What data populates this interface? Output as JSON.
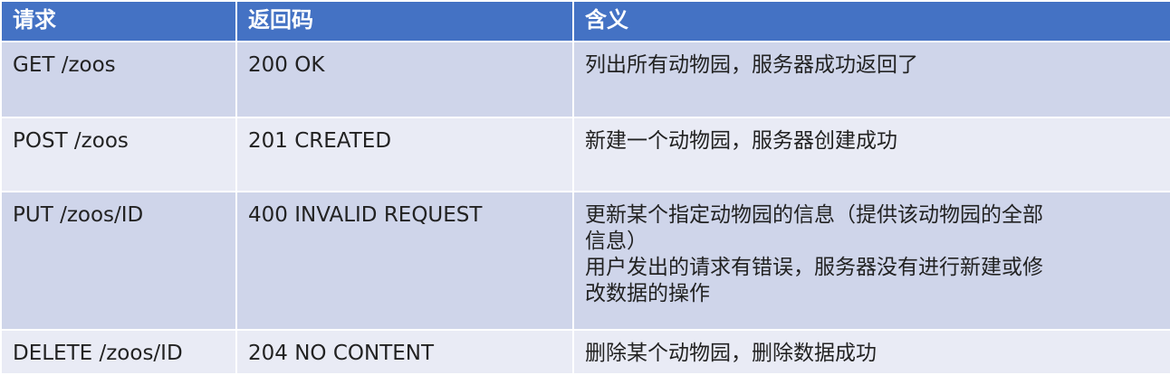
{
  "table": {
    "headers": [
      "请求",
      "返回码",
      "含义"
    ],
    "rows": [
      {
        "request": "GET /zoos",
        "code": "200 OK",
        "meaning": [
          "列出所有动物园，服务器成功返回了"
        ]
      },
      {
        "request": "POST /zoos",
        "code": "201 CREATED",
        "meaning": [
          "新建一个动物园，服务器创建成功"
        ]
      },
      {
        "request": "PUT /zoos/ID",
        "code": "400 INVALID REQUEST",
        "meaning": [
          "更新某个指定动物园的信息（提供该动物园的全部",
          "信息）",
          "用户发出的请求有错误，服务器没有进行新建或修",
          "改数据的操作"
        ]
      },
      {
        "request": "DELETE /zoos/ID",
        "code": "204 NO CONTENT",
        "meaning": [
          "删除某个动物园，删除数据成功"
        ]
      }
    ],
    "colors": {
      "header_bg": "#4472c4",
      "row_dark": "#cfd5ea",
      "row_light": "#e9ebf5"
    }
  }
}
